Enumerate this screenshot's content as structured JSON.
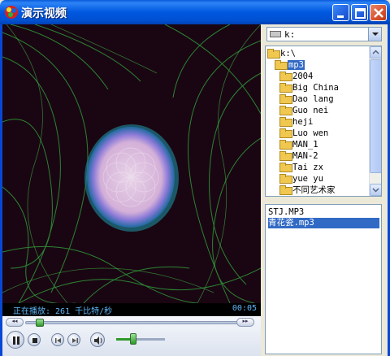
{
  "window": {
    "title": "演示视频",
    "accent": "#0058E0"
  },
  "player": {
    "status_text": "正在播放: 261 千比特/秒",
    "time": "00:05",
    "seek_back_label": "◂◂",
    "seek_forward_label": "▸▸",
    "progress_fraction": 0.05,
    "volume_fraction": 0.35
  },
  "drive": {
    "label": "k:"
  },
  "tree": {
    "root": "k:\\",
    "selected": "mp3",
    "folders": [
      "2004",
      "Big China",
      "Dao lang",
      "Guo nei",
      "heji",
      "Luo wen",
      "MAN_1",
      "MAN-2",
      "Tai zx",
      "yue yu",
      "不同艺术家"
    ]
  },
  "files": {
    "items": [
      "STJ.MP3",
      "青花瓷.mp3"
    ],
    "selected_index": 1
  },
  "icons": {
    "minimize": "minimize-icon",
    "maximize": "maximize-icon",
    "close": "close-icon",
    "play_pause": "pause-icon",
    "stop": "stop-icon",
    "prev": "previous-icon",
    "next": "next-icon",
    "volume": "speaker-icon"
  }
}
